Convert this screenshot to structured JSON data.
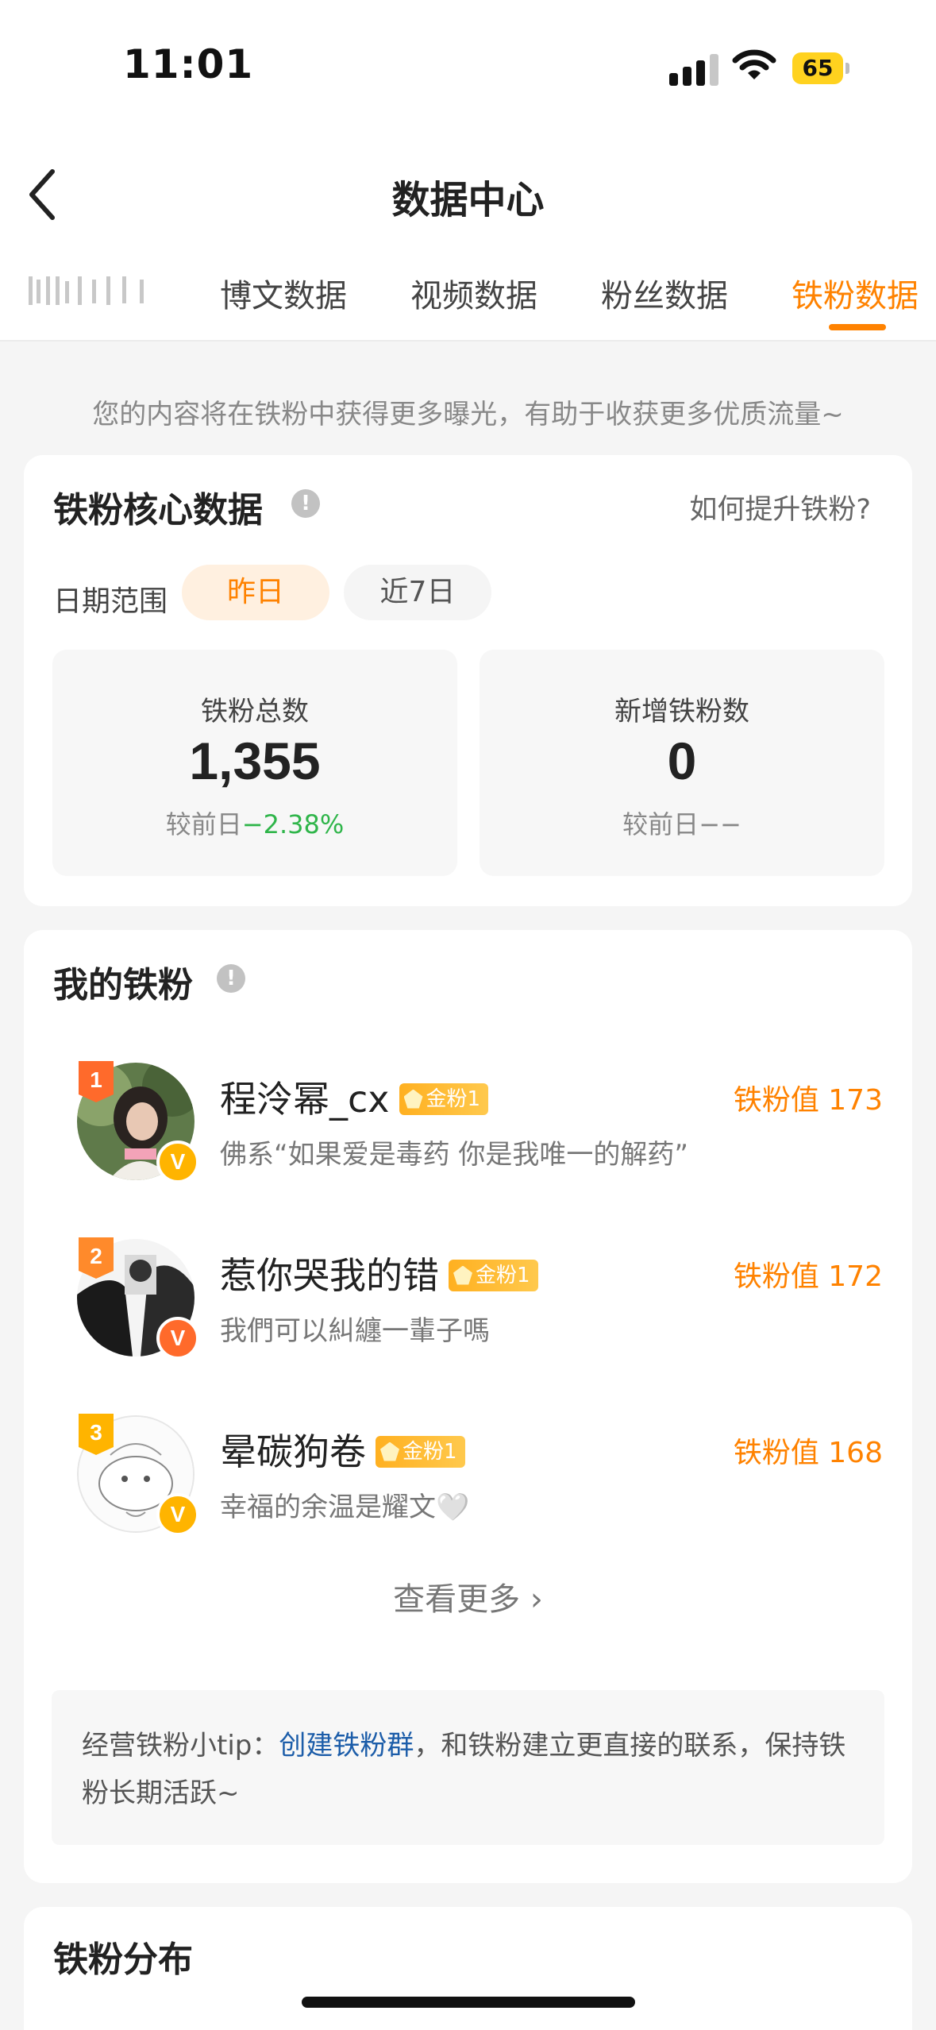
{
  "status_bar": {
    "time": "11:01",
    "battery": "65"
  },
  "header": {
    "title": "数据中心"
  },
  "tabs": [
    {
      "label": "博文数据"
    },
    {
      "label": "视频数据"
    },
    {
      "label": "粉丝数据"
    },
    {
      "label": "铁粉数据",
      "active": true
    }
  ],
  "hint": "您的内容将在铁粉中获得更多曝光，有助于收获更多优质流量~",
  "core": {
    "title": "铁粉核心数据",
    "help_link": "如何提升铁粉?",
    "range_label": "日期范围",
    "range_options": [
      "昨日",
      "近7日"
    ],
    "stats": [
      {
        "label": "铁粉总数",
        "value": "1,355",
        "compare_prefix": "较前日",
        "compare_value": "−2.38%"
      },
      {
        "label": "新增铁粉数",
        "value": "0",
        "compare_prefix": "较前日",
        "compare_value": "−−"
      }
    ]
  },
  "fans": {
    "title": "我的铁粉",
    "badge_label": "金粉1",
    "list": [
      {
        "rank": "1",
        "name": "程泠幂_cx",
        "bio": "佛系“如果爱是毒药 你是我唯一的解药”",
        "score": "铁粉值 173"
      },
      {
        "rank": "2",
        "name": "惹你哭我的错",
        "bio": "我們可以糾纏一輩子嗎",
        "score": "铁粉值 172"
      },
      {
        "rank": "3",
        "name": "晕碳狗卷",
        "bio": "幸福的余温是耀文🤍",
        "score": "铁粉值 168"
      }
    ],
    "more": "查看更多",
    "tip_prefix": "经营铁粉小tip：",
    "tip_link": "创建铁粉群",
    "tip_suffix": "，和铁粉建立更直接的联系，保持铁粉长期活跃~"
  },
  "distribution": {
    "title": "铁粉分布"
  },
  "colors": {
    "accent": "#ff8200",
    "link": "#1c5da9",
    "negative": "#2fb54a",
    "gold_badge": "#ffb020"
  }
}
